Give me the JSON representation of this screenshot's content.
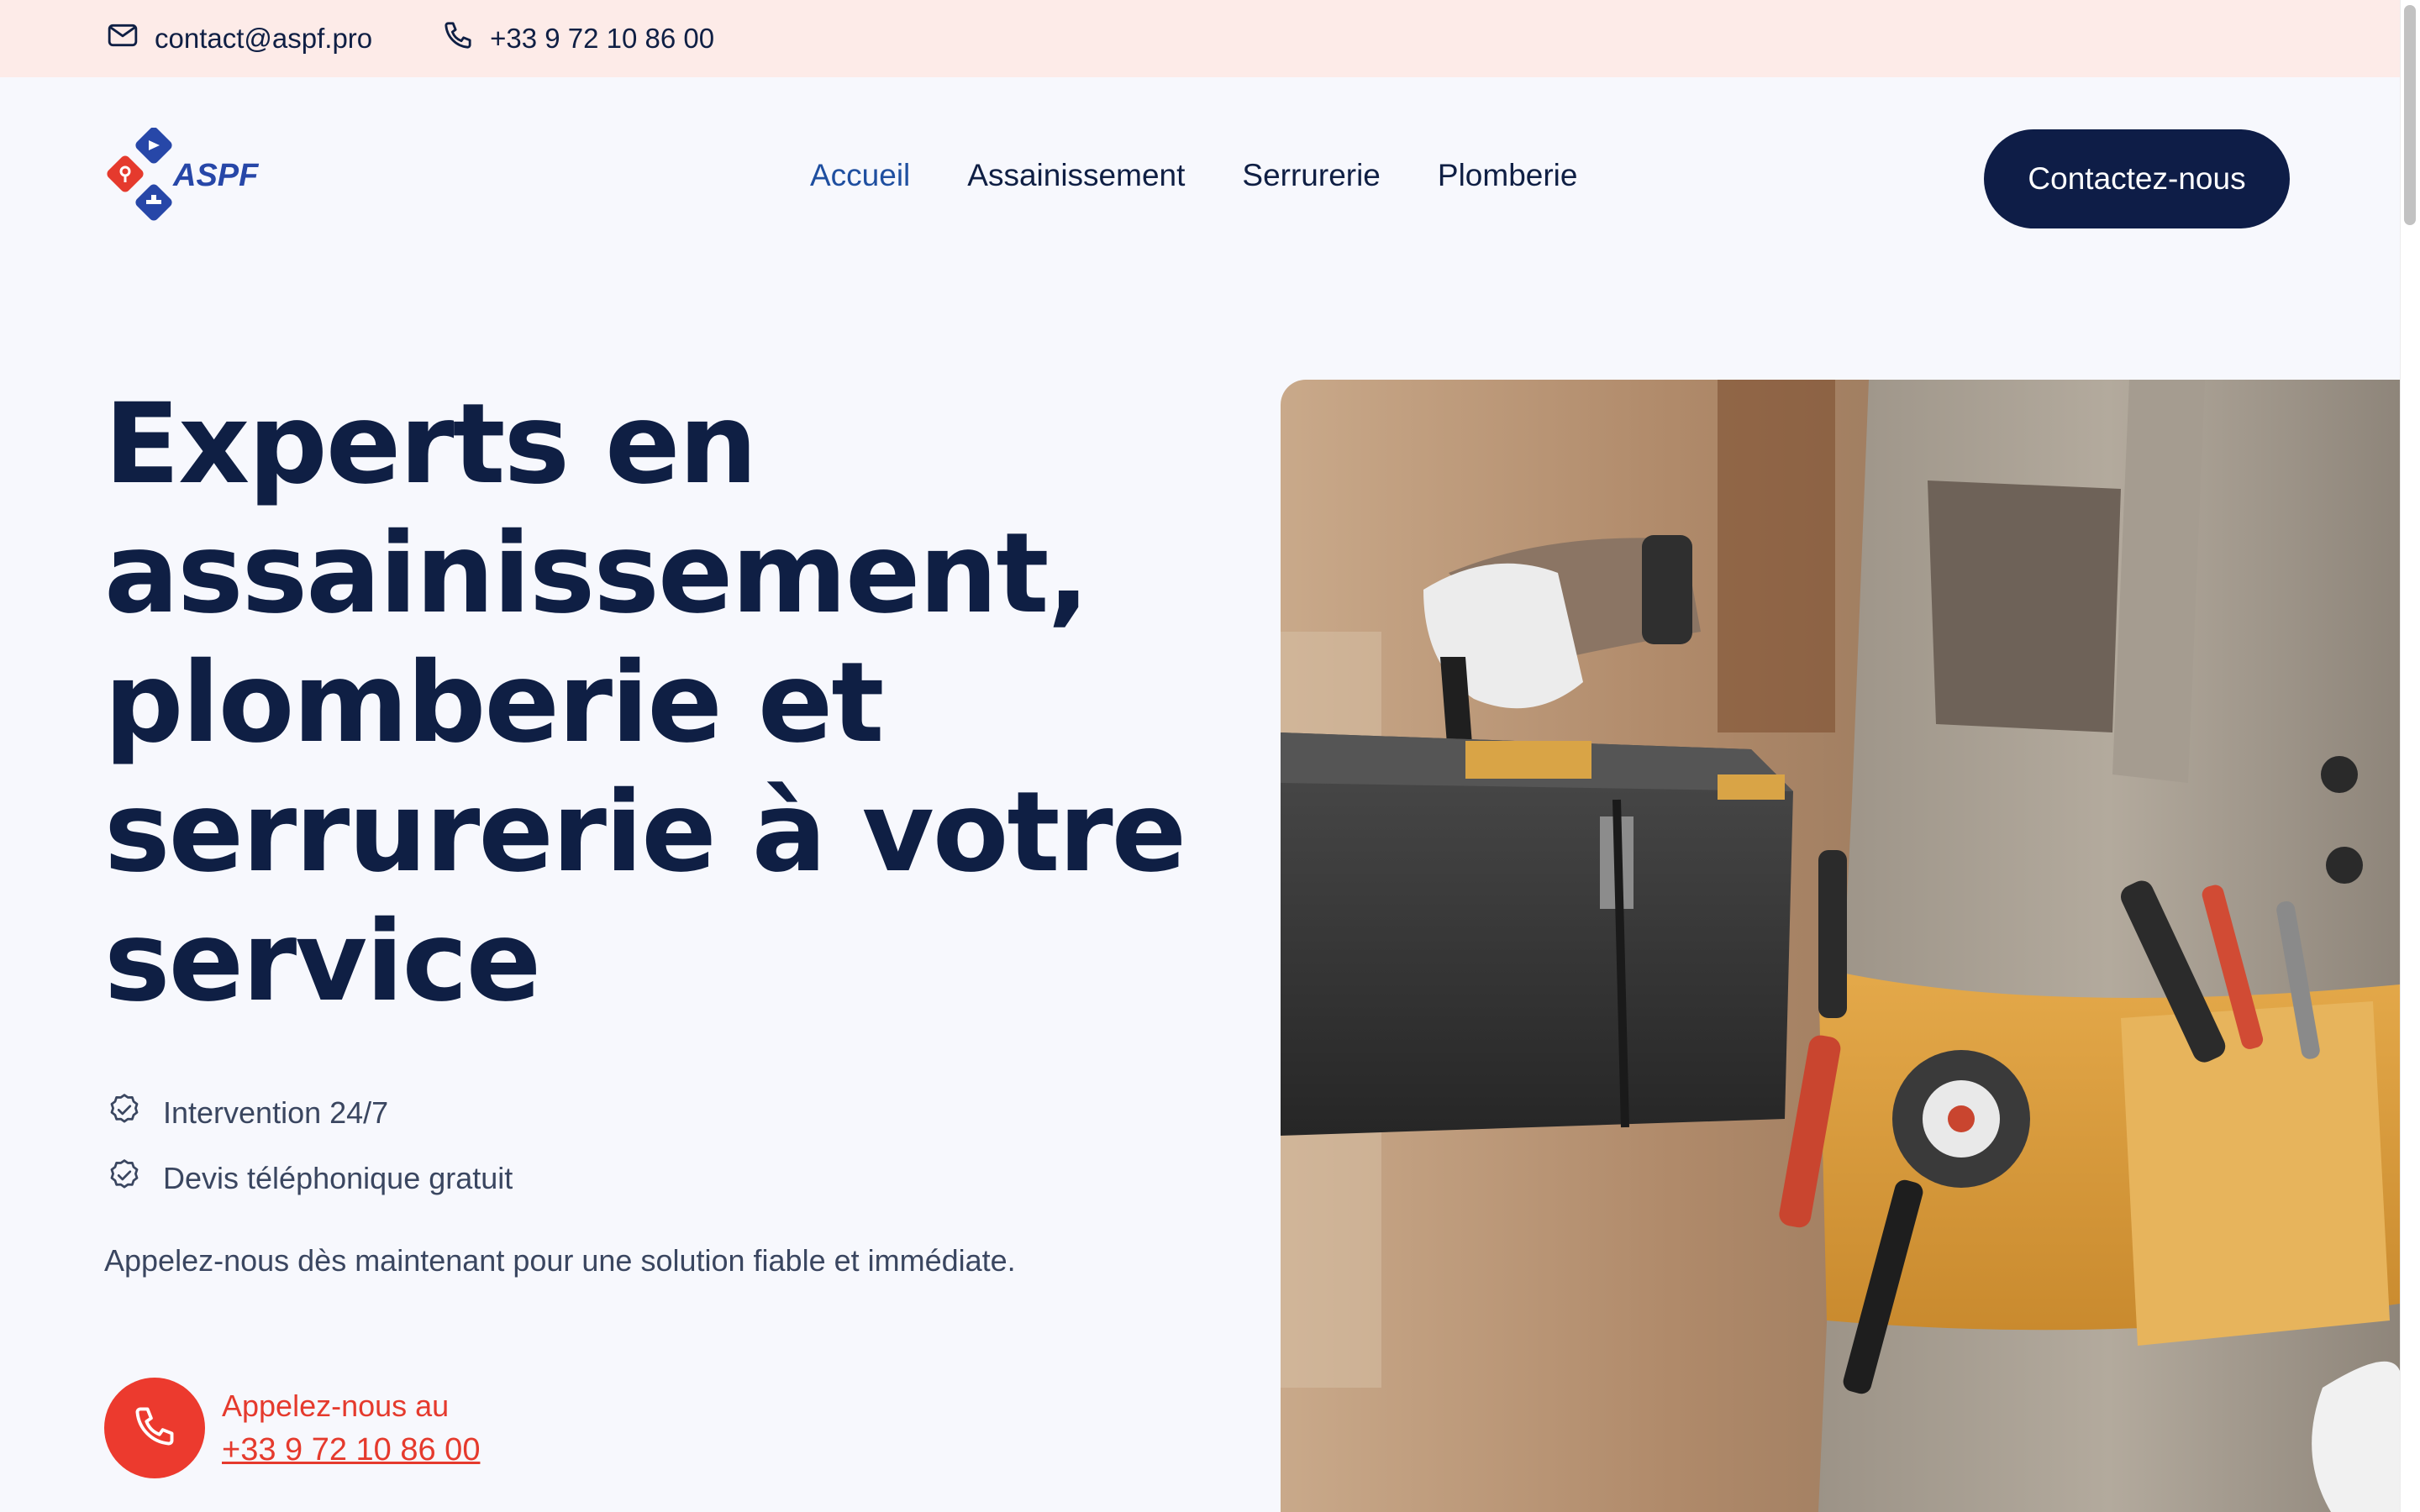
{
  "topbar": {
    "email": "contact@aspf.pro",
    "phone": "+33 9 72 10 86 00"
  },
  "header": {
    "logo_text": "ASPF",
    "nav": [
      {
        "label": "Accueil",
        "active": true
      },
      {
        "label": "Assainissement",
        "active": false
      },
      {
        "label": "Serrurerie",
        "active": false
      },
      {
        "label": "Plomberie",
        "active": false
      }
    ],
    "cta_label": "Contactez-nous"
  },
  "hero": {
    "title_lines": [
      "Experts en",
      "assainissement,",
      "plomberie et",
      "serrurerie à votre",
      "service"
    ],
    "features": [
      "Intervention 24/7",
      "Devis téléphonique gratuit"
    ],
    "subtitle": "Appelez-nous dès maintenant pour une solution fiable et immédiate.",
    "call_label": "Appelez-nous au",
    "call_number": "+33 9 72 10 86 00"
  },
  "colors": {
    "navy": "#0f1f44",
    "accent_blue": "#1f4fa0",
    "accent_red": "#ec3a2e",
    "topbar_bg": "#fdebe8",
    "page_bg": "#f7f8fd"
  },
  "icons": {
    "email": "mail-icon",
    "phone": "phone-icon",
    "feature": "check-badge-icon",
    "call": "phone-icon"
  }
}
